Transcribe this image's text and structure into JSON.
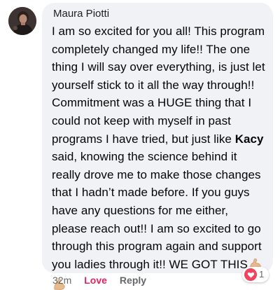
{
  "comment": {
    "author": "Maura Piotti",
    "text_before_mention": "I am so excited for you all! This program completely changed my life!! The one thing I will say over everything, is just let yourself stick to it all the way through!! Commitment was a HUGE thing that I could not keep with myself in past programs I have tried, but just like ",
    "mention": "Kacy",
    "text_after_mention": " said, knowing the science behind it really drove me to make those changes that I hadn’t made before. If you guys have any questions for me either, please reach out!! I am so excited to go through this program again and support you ladies through it!! WE GOT THIS",
    "emoji": [
      "flexed-biceps-icon",
      "flexed-biceps-icon"
    ]
  },
  "actions": {
    "timestamp": "32m",
    "love_label": "Love",
    "reply_label": "Reply"
  },
  "reactions": {
    "icon": "heart-icon",
    "count": "1"
  },
  "colors": {
    "bubble_background": "#f0f2f5",
    "love_active": "#e0245e",
    "heart_reaction": "#f3425f",
    "secondary_text": "#65676b"
  }
}
